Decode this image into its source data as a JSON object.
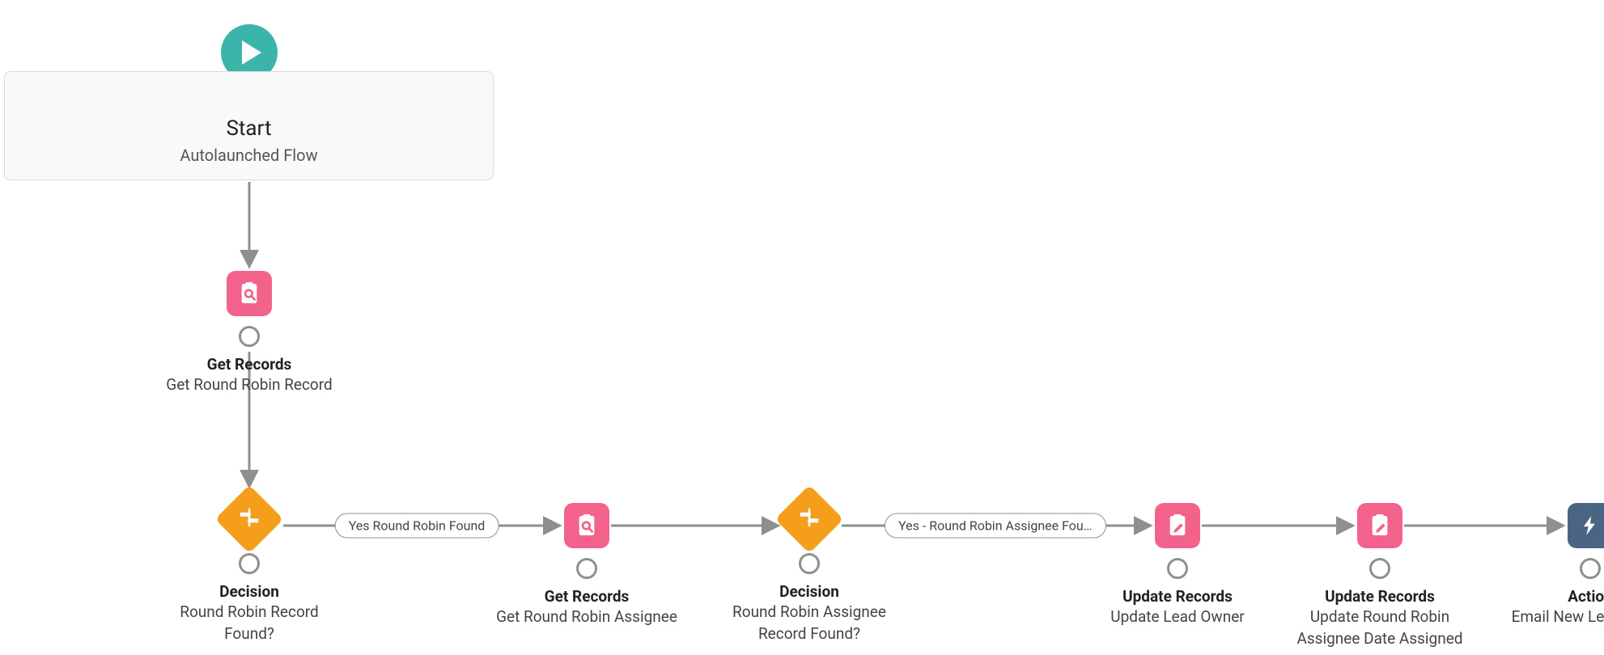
{
  "start": {
    "title": "Start",
    "subtitle": "Autolaunched Flow"
  },
  "nodes": {
    "getRecords1": {
      "type": "Get Records",
      "name": "Get Round Robin Record"
    },
    "decision1": {
      "type": "Decision",
      "name_l1": "Round Robin Record",
      "name_l2": "Found?"
    },
    "branch1": {
      "label": "Yes Round Robin Found"
    },
    "getRecords2": {
      "type": "Get Records",
      "name": "Get Round Robin Assignee"
    },
    "decision2": {
      "type": "Decision",
      "name_l1": "Round Robin Assignee",
      "name_l2": "Record Found?"
    },
    "branch2": {
      "label": "Yes - Round Robin Assignee Fou…"
    },
    "update1": {
      "type": "Update Records",
      "name": "Update Lead Owner"
    },
    "update2": {
      "type": "Update Records",
      "name_l1": "Update Round Robin",
      "name_l2": "Assignee Date Assigned"
    },
    "action1": {
      "type": "Action",
      "name": "Email New Lead Owner"
    }
  }
}
